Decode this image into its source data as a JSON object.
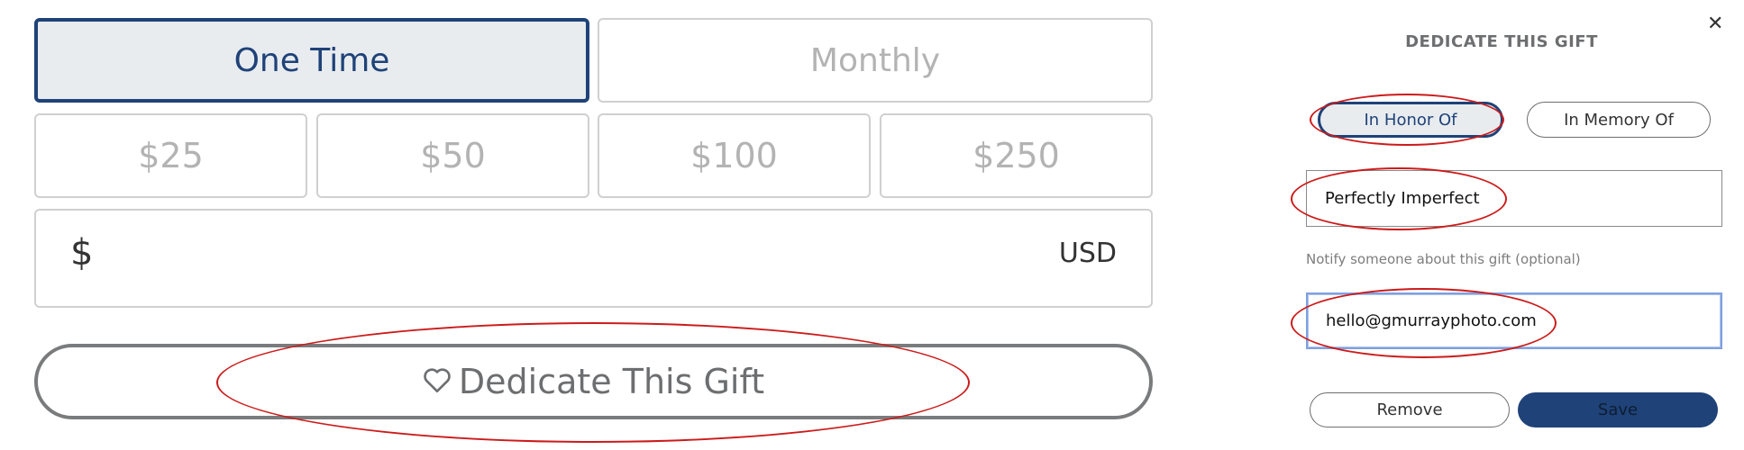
{
  "frequency": {
    "one_time": "One Time",
    "monthly": "Monthly"
  },
  "amounts": [
    "$25",
    "$50",
    "$100",
    "$250"
  ],
  "custom_amount": {
    "symbol": "$",
    "currency": "USD",
    "value": ""
  },
  "dedicate_button": {
    "label": "Dedicate This Gift",
    "icon": "heart-icon"
  },
  "modal": {
    "title": "DEDICATE THIS GIFT",
    "close_icon": "close-icon",
    "honor_label": "In Honor Of",
    "memory_label": "In Memory Of",
    "honoree_value": "Perfectly Imperfect",
    "notify_helper": "Notify someone about this gift (optional)",
    "email_value": "hello@gmurrayphoto.com",
    "remove_label": "Remove",
    "save_label": "Save"
  },
  "colors": {
    "accent": "#1f4278",
    "annotation": "#cc1b1b",
    "active_bg": "#e8ecef"
  }
}
